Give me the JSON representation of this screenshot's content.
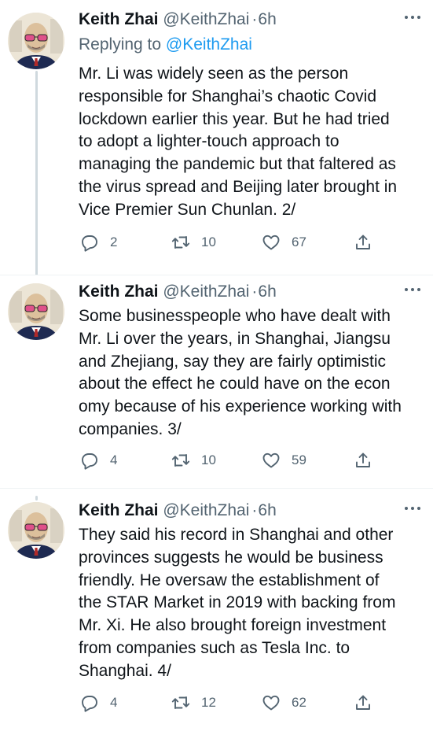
{
  "tweets": [
    {
      "author_name": "Keith Zhai",
      "handle": "@KeithZhai",
      "separator": "·",
      "time": "6h",
      "replying_prefix": "Replying to",
      "replying_handle": "@KeithZhai",
      "text": "Mr. Li was widely seen as the person\nresponsible for Shanghai’s chaotic Covid\nlockdown earlier this year. But he had tried\nto adopt a lighter-touch approach to\nmanaging the pandemic but that faltered as\nthe virus spread and Beijing later brought in\nVice Premier Sun Chunlan. 2/",
      "replies": "2",
      "retweets": "10",
      "likes": "67"
    },
    {
      "author_name": "Keith Zhai",
      "handle": "@KeithZhai",
      "separator": "·",
      "time": "6h",
      "text": "Some businesspeople who have dealt with\nMr. Li over the years, in Shanghai, Jiangsu\nand Zhejiang, say they are fairly optimistic\nabout the effect he could have on the econ\nomy because of his experience working with\ncompanies. 3/",
      "replies": "4",
      "retweets": "10",
      "likes": "59"
    },
    {
      "author_name": "Keith Zhai",
      "handle": "@KeithZhai",
      "separator": "·",
      "time": "6h",
      "text": "They said his record in Shanghai and other\nprovinces suggests he would be business\nfriendly. He oversaw the establishment of\nthe STAR Market in 2019 with backing from\nMr. Xi. He also brought foreign investment\nfrom companies such as Tesla Inc. to\nShanghai. 4/",
      "replies": "4",
      "retweets": "12",
      "likes": "62"
    }
  ],
  "colors": {
    "text": "#0f1419",
    "secondary": "#536471",
    "link": "#1d9bf0",
    "thread_line": "#cfd9de",
    "divider": "#eff3f4"
  },
  "icons": [
    "more-icon",
    "reply-icon",
    "retweet-icon",
    "like-icon",
    "share-icon"
  ]
}
